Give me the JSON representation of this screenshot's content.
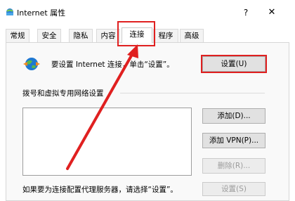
{
  "window": {
    "title": "Internet 属性",
    "help_label": "?",
    "close_label": "✕"
  },
  "tabs": [
    {
      "label": "常规",
      "active": false
    },
    {
      "label": "安全",
      "active": false
    },
    {
      "label": "隐私",
      "active": false
    },
    {
      "label": "内容",
      "active": false
    },
    {
      "label": "连接",
      "active": true
    },
    {
      "label": "程序",
      "active": false
    },
    {
      "label": "高级",
      "active": false
    }
  ],
  "connection": {
    "setup_text": "要设置 Internet 连接，单击“设置”。",
    "setup_button": "设置(U)",
    "dialup_group_label": "拨号和虚拟专用网络设置",
    "add_button": "添加(D)...",
    "add_vpn_button": "添加 VPN(P)...",
    "remove_button": "删除(R)...",
    "proxy_text": "如果要为连接配置代理服务器，请选择“设置”。",
    "settings_button": "设置(S)",
    "settings_button_enabled": false,
    "remove_button_enabled": false
  },
  "annotation": {
    "color": "#e02020"
  }
}
